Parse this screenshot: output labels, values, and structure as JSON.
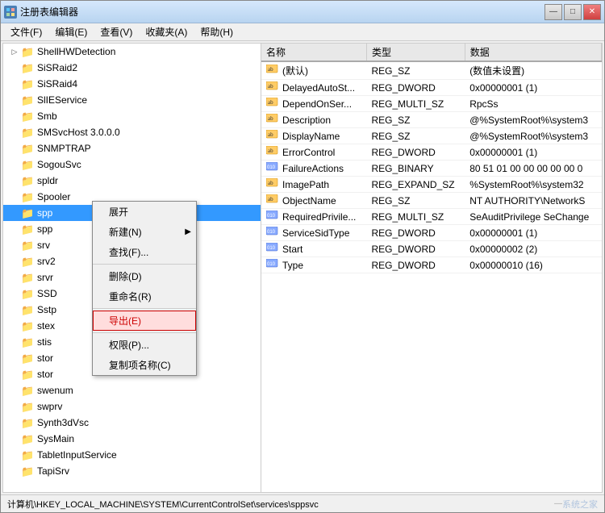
{
  "window": {
    "title": "注册表编辑器",
    "icon": "reg"
  },
  "titleBtns": [
    "—",
    "□",
    "✕"
  ],
  "menuBar": {
    "items": [
      "文件(F)",
      "编辑(E)",
      "查看(V)",
      "收藏夹(A)",
      "帮助(H)"
    ]
  },
  "leftPanel": {
    "treeItems": [
      {
        "name": "ShellHWDetection",
        "level": 1,
        "hasExpand": true,
        "selected": false
      },
      {
        "name": "SiSRaid2",
        "level": 1,
        "hasExpand": false,
        "selected": false
      },
      {
        "name": "SiSRaid4",
        "level": 1,
        "hasExpand": false,
        "selected": false
      },
      {
        "name": "SlIEService",
        "level": 1,
        "hasExpand": false,
        "selected": false
      },
      {
        "name": "Smb",
        "level": 1,
        "hasExpand": false,
        "selected": false
      },
      {
        "name": "SMSvcHost 3.0.0.0",
        "level": 1,
        "hasExpand": false,
        "selected": false
      },
      {
        "name": "SNMPTRAP",
        "level": 1,
        "hasExpand": false,
        "selected": false
      },
      {
        "name": "SogouSvc",
        "level": 1,
        "hasExpand": false,
        "selected": false
      },
      {
        "name": "spldr",
        "level": 1,
        "hasExpand": false,
        "selected": false
      },
      {
        "name": "Spooler",
        "level": 1,
        "hasExpand": false,
        "selected": false
      },
      {
        "name": "spp",
        "level": 1,
        "hasExpand": false,
        "selected": true
      },
      {
        "name": "spp",
        "level": 1,
        "hasExpand": false,
        "selected": false
      },
      {
        "name": "srv",
        "level": 1,
        "hasExpand": false,
        "selected": false
      },
      {
        "name": "srv2",
        "level": 1,
        "hasExpand": false,
        "selected": false
      },
      {
        "name": "srvr",
        "level": 1,
        "hasExpand": false,
        "selected": false
      },
      {
        "name": "SSD",
        "level": 1,
        "hasExpand": false,
        "selected": false
      },
      {
        "name": "Sstp",
        "level": 1,
        "hasExpand": false,
        "selected": false
      },
      {
        "name": "stex",
        "level": 1,
        "hasExpand": false,
        "selected": false
      },
      {
        "name": "stis",
        "level": 1,
        "hasExpand": false,
        "selected": false
      },
      {
        "name": "stor",
        "level": 1,
        "hasExpand": false,
        "selected": false
      },
      {
        "name": "stor",
        "level": 1,
        "hasExpand": false,
        "selected": false
      },
      {
        "name": "swenum",
        "level": 1,
        "hasExpand": false,
        "selected": false
      },
      {
        "name": "swprv",
        "level": 1,
        "hasExpand": false,
        "selected": false
      },
      {
        "name": "Synth3dVsc",
        "level": 1,
        "hasExpand": false,
        "selected": false
      },
      {
        "name": "SysMain",
        "level": 1,
        "hasExpand": false,
        "selected": false
      },
      {
        "name": "TabletInputService",
        "level": 1,
        "hasExpand": false,
        "selected": false
      },
      {
        "name": "TapiSrv",
        "level": 1,
        "hasExpand": false,
        "selected": false
      }
    ]
  },
  "contextMenu": {
    "items": [
      {
        "label": "展开",
        "hasArrow": false,
        "type": "normal"
      },
      {
        "label": "新建(N)",
        "hasArrow": true,
        "type": "normal"
      },
      {
        "label": "查找(F)...",
        "hasArrow": false,
        "type": "normal"
      },
      {
        "label": "删除(D)",
        "hasArrow": false,
        "type": "normal"
      },
      {
        "label": "重命名(R)",
        "hasArrow": false,
        "type": "normal"
      },
      {
        "label": "导出(E)",
        "hasArrow": false,
        "type": "highlighted"
      },
      {
        "label": "权限(P)...",
        "hasArrow": false,
        "type": "normal"
      },
      {
        "label": "复制项名称(C)",
        "hasArrow": false,
        "type": "normal"
      }
    ]
  },
  "rightPanel": {
    "columns": [
      "名称",
      "类型",
      "数据"
    ],
    "rows": [
      {
        "name": "(默认)",
        "type": "REG_SZ",
        "data": "(数值未设置)",
        "icon": "ab"
      },
      {
        "name": "DelayedAutoSt...",
        "type": "REG_DWORD",
        "data": "0x00000001 (1)",
        "icon": "ab"
      },
      {
        "name": "DependOnSer...",
        "type": "REG_MULTI_SZ",
        "data": "RpcSs",
        "icon": "ab"
      },
      {
        "name": "Description",
        "type": "REG_SZ",
        "data": "@%SystemRoot%\\system3",
        "icon": "ab"
      },
      {
        "name": "DisplayName",
        "type": "REG_SZ",
        "data": "@%SystemRoot%\\system3",
        "icon": "ab"
      },
      {
        "name": "ErrorControl",
        "type": "REG_DWORD",
        "data": "0x00000001 (1)",
        "icon": "ab"
      },
      {
        "name": "FailureActions",
        "type": "REG_BINARY",
        "data": "80 51 01 00 00 00 00 00 0",
        "icon": "bin"
      },
      {
        "name": "ImagePath",
        "type": "REG_EXPAND_SZ",
        "data": "%SystemRoot%\\system32",
        "icon": "ab"
      },
      {
        "name": "ObjectName",
        "type": "REG_SZ",
        "data": "NT AUTHORITY\\NetworkS",
        "icon": "ab"
      },
      {
        "name": "RequiredPrivile...",
        "type": "REG_MULTI_SZ",
        "data": "SeAuditPrivilege SeChange",
        "icon": "bin"
      },
      {
        "name": "ServiceSidType",
        "type": "REG_DWORD",
        "data": "0x00000001 (1)",
        "icon": "bin"
      },
      {
        "name": "Start",
        "type": "REG_DWORD",
        "data": "0x00000002 (2)",
        "icon": "bin"
      },
      {
        "name": "Type",
        "type": "REG_DWORD",
        "data": "0x00000010 (16)",
        "icon": "bin"
      }
    ]
  },
  "statusBar": {
    "path": "计算机\\HKEY_LOCAL_MACHINE\\SYSTEM\\CurrentControlSet\\services\\sppsvc",
    "watermark": "系统之家"
  }
}
